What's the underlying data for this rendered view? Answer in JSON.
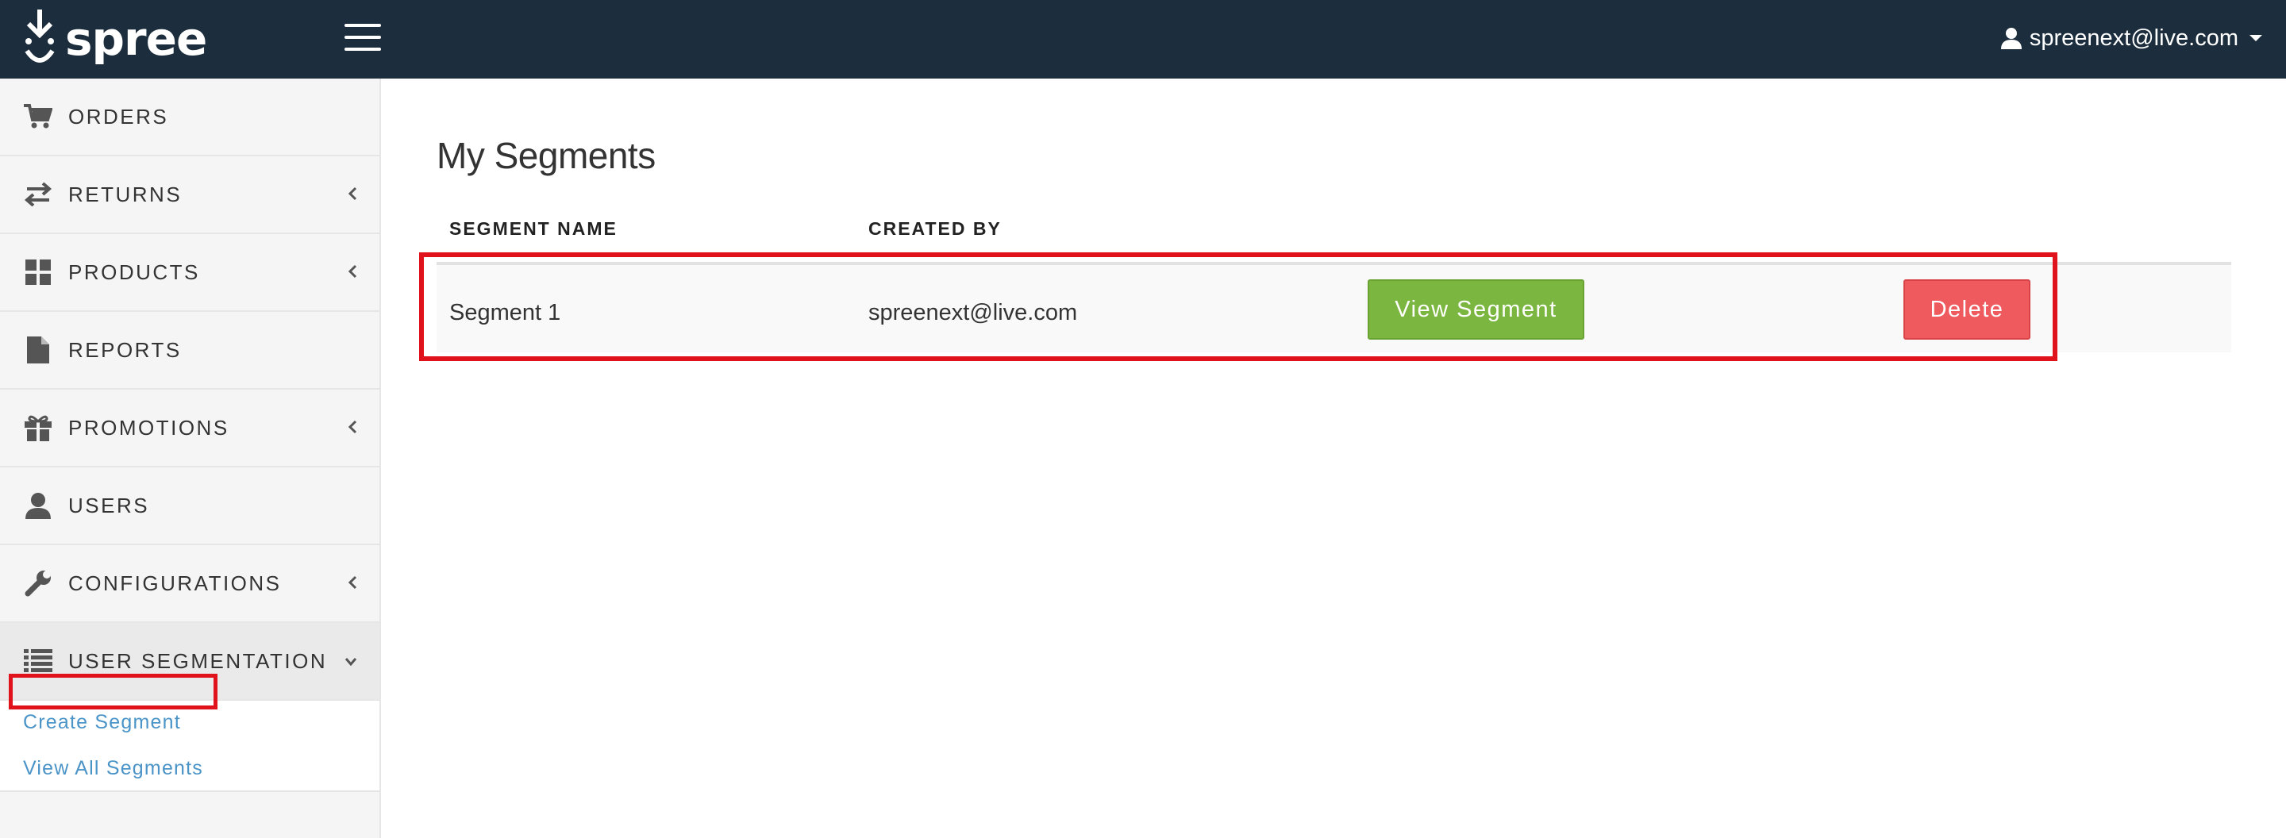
{
  "header": {
    "brand": "spree",
    "user_email": "spreenext@live.com"
  },
  "sidebar": {
    "items": [
      {
        "label": "ORDERS",
        "icon": "cart-icon",
        "has_chevron": false
      },
      {
        "label": "RETURNS",
        "icon": "exchange-icon",
        "has_chevron": true
      },
      {
        "label": "PRODUCTS",
        "icon": "grid-icon",
        "has_chevron": true
      },
      {
        "label": "REPORTS",
        "icon": "file-icon",
        "has_chevron": false
      },
      {
        "label": "PROMOTIONS",
        "icon": "gift-icon",
        "has_chevron": true
      },
      {
        "label": "USERS",
        "icon": "user-icon",
        "has_chevron": false
      },
      {
        "label": "CONFIGURATIONS",
        "icon": "wrench-icon",
        "has_chevron": true
      },
      {
        "label": "USER SEGMENTATION",
        "icon": "list-icon",
        "has_chevron": true,
        "expanded": true
      }
    ],
    "subnav": {
      "create_label": "Create Segment",
      "view_all_label": "View All Segments"
    }
  },
  "main": {
    "title": "My Segments",
    "columns": [
      "SEGMENT NAME",
      "CREATED BY"
    ],
    "rows": [
      {
        "name": "Segment 1",
        "created_by": "spreenext@live.com",
        "view_label": "View Segment",
        "delete_label": "Delete"
      }
    ]
  },
  "colors": {
    "topbar": "#1c2d3d",
    "link": "#4b94c8",
    "view_button": "#7bb640",
    "delete_button": "#ef5a5f",
    "highlight": "#e0121c"
  }
}
